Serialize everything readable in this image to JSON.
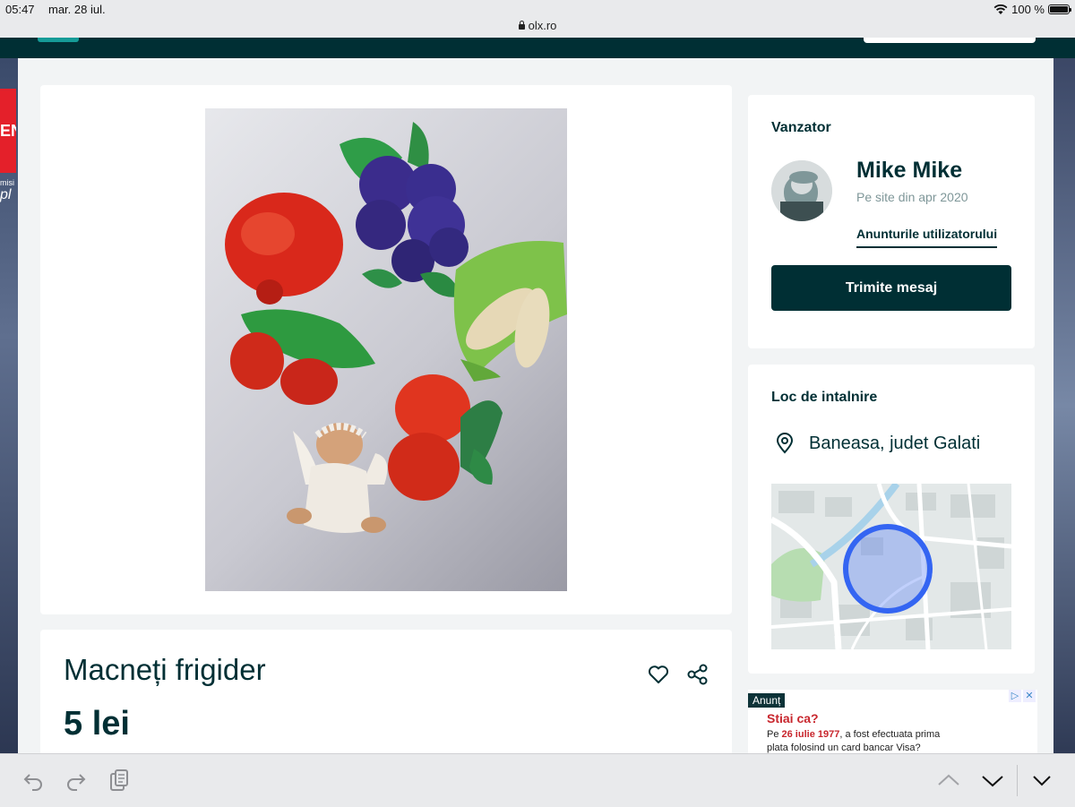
{
  "status_bar": {
    "time": "05:47",
    "date": "mar. 28 iul.",
    "url": "olx.ro",
    "battery": "100 %"
  },
  "left_banner": {
    "text_top": "EN",
    "text_mid": "misi",
    "text_bot": "pl"
  },
  "listing": {
    "title": "Macneți frigider",
    "price": "5 lei"
  },
  "seller": {
    "section_label": "Vanzator",
    "name": "Mike Mike",
    "member_since": "Pe site din apr 2020",
    "user_ads_link": "Anunturile utilizatorului",
    "message_button": "Trimite mesaj"
  },
  "location": {
    "section_label": "Loc de intalnire",
    "place": "Baneasa, judet Galati"
  },
  "ad": {
    "tag": "Anunț",
    "headline": "Stiai ca?",
    "line1_prefix": "Pe ",
    "line1_date": "26 iulie 1977",
    "line1_suffix": ", a fost efectuata prima",
    "line2": "plata folosind un card bancar Visa?"
  },
  "colors": {
    "brand_dark": "#002f34",
    "brand_accent": "#23e5db",
    "ad_red": "#c8262d"
  },
  "icons": {
    "heart": "heart-icon",
    "share": "share-icon",
    "pin": "map-pin-icon",
    "undo": "undo-icon",
    "redo": "redo-icon",
    "clipboard": "clipboard-icon"
  }
}
